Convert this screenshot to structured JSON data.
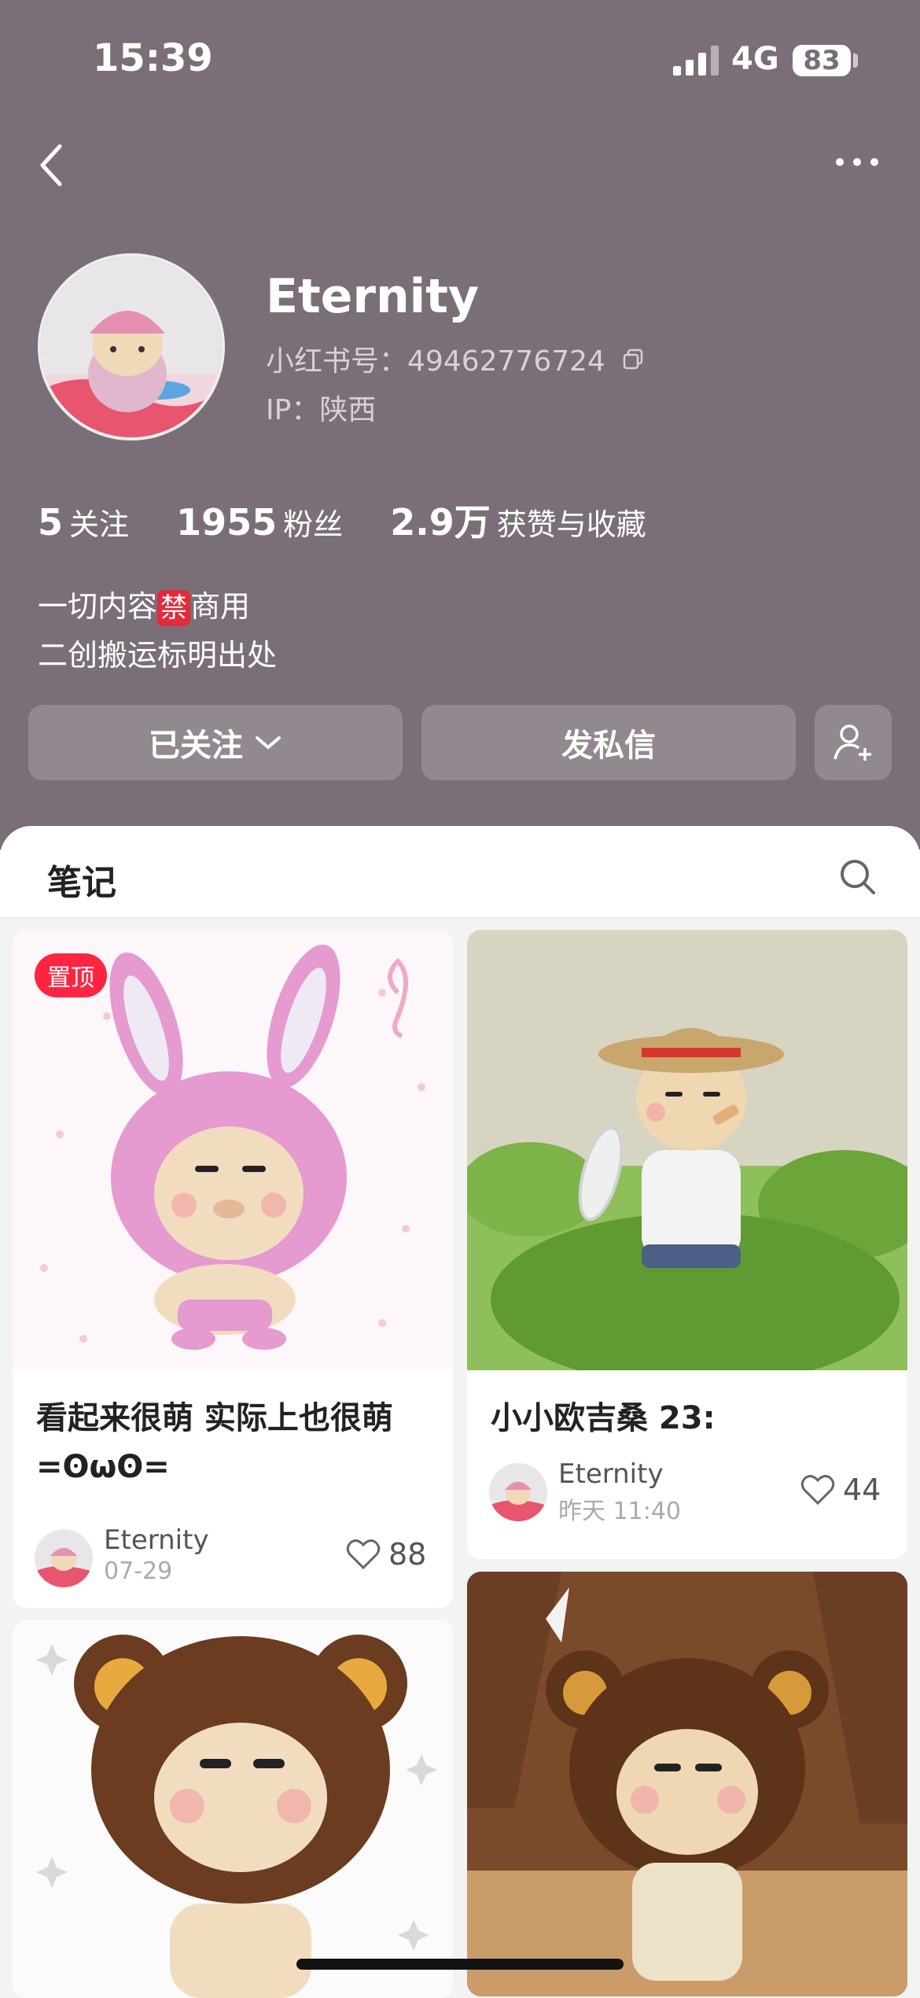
{
  "status_bar": {
    "time": "15:39",
    "network": "4G",
    "battery": "83"
  },
  "profile": {
    "name": "Eternity",
    "red_id": "小红书号：49462776724",
    "ip": "IP：陕西",
    "stats": [
      {
        "value": "5",
        "label": "关注"
      },
      {
        "value": "1955",
        "label": "粉丝"
      },
      {
        "value": "2.9万",
        "label": "获赞与收藏"
      }
    ],
    "bio_line1_a": "一切内容",
    "bio_ban": "禁",
    "bio_line1_b": "商用",
    "bio_line2": "二创搬运标明出处"
  },
  "actions": {
    "follow": "已关注",
    "message": "发私信"
  },
  "tabs": {
    "notes": "笔记"
  },
  "notes": [
    {
      "pin": "置顶",
      "title": "看起来很萌 实际上也很萌 =ʘωʘ=",
      "user": "Eternity",
      "date": "07-29",
      "likes": "88"
    },
    {
      "title": "小小欧吉桑 23:",
      "user": "Eternity",
      "date": "昨天 11:40",
      "likes": "44"
    }
  ],
  "colors": {
    "header_bg": "#7a6f78",
    "accent": "#ff2442"
  }
}
